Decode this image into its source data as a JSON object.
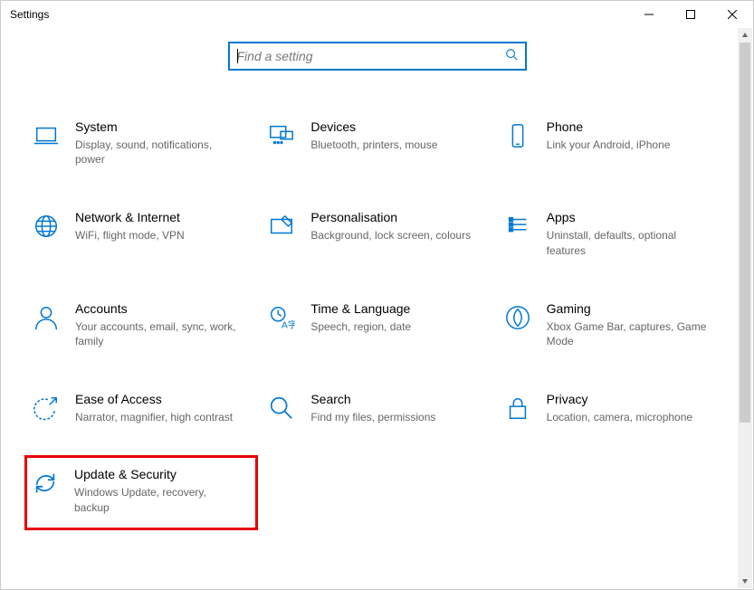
{
  "window": {
    "title": "Settings"
  },
  "search": {
    "placeholder": "Find a setting"
  },
  "categories": [
    {
      "id": "system",
      "title": "System",
      "desc": "Display, sound, notifications, power",
      "icon": "laptop-icon"
    },
    {
      "id": "devices",
      "title": "Devices",
      "desc": "Bluetooth, printers, mouse",
      "icon": "devices-icon"
    },
    {
      "id": "phone",
      "title": "Phone",
      "desc": "Link your Android, iPhone",
      "icon": "phone-icon"
    },
    {
      "id": "network",
      "title": "Network & Internet",
      "desc": "WiFi, flight mode, VPN",
      "icon": "globe-icon"
    },
    {
      "id": "personalisation",
      "title": "Personalisation",
      "desc": "Background, lock screen, colours",
      "icon": "personalisation-icon"
    },
    {
      "id": "apps",
      "title": "Apps",
      "desc": "Uninstall, defaults, optional features",
      "icon": "apps-icon"
    },
    {
      "id": "accounts",
      "title": "Accounts",
      "desc": "Your accounts, email, sync, work, family",
      "icon": "person-icon"
    },
    {
      "id": "time-language",
      "title": "Time & Language",
      "desc": "Speech, region, date",
      "icon": "time-language-icon"
    },
    {
      "id": "gaming",
      "title": "Gaming",
      "desc": "Xbox Game Bar, captures, Game Mode",
      "icon": "gaming-icon"
    },
    {
      "id": "ease-of-access",
      "title": "Ease of Access",
      "desc": "Narrator, magnifier, high contrast",
      "icon": "ease-of-access-icon"
    },
    {
      "id": "search",
      "title": "Search",
      "desc": "Find my files, permissions",
      "icon": "search-category-icon"
    },
    {
      "id": "privacy",
      "title": "Privacy",
      "desc": "Location, camera, microphone",
      "icon": "lock-icon"
    },
    {
      "id": "update-security",
      "title": "Update & Security",
      "desc": "Windows Update, recovery, backup",
      "icon": "update-icon",
      "highlighted": true
    }
  ]
}
